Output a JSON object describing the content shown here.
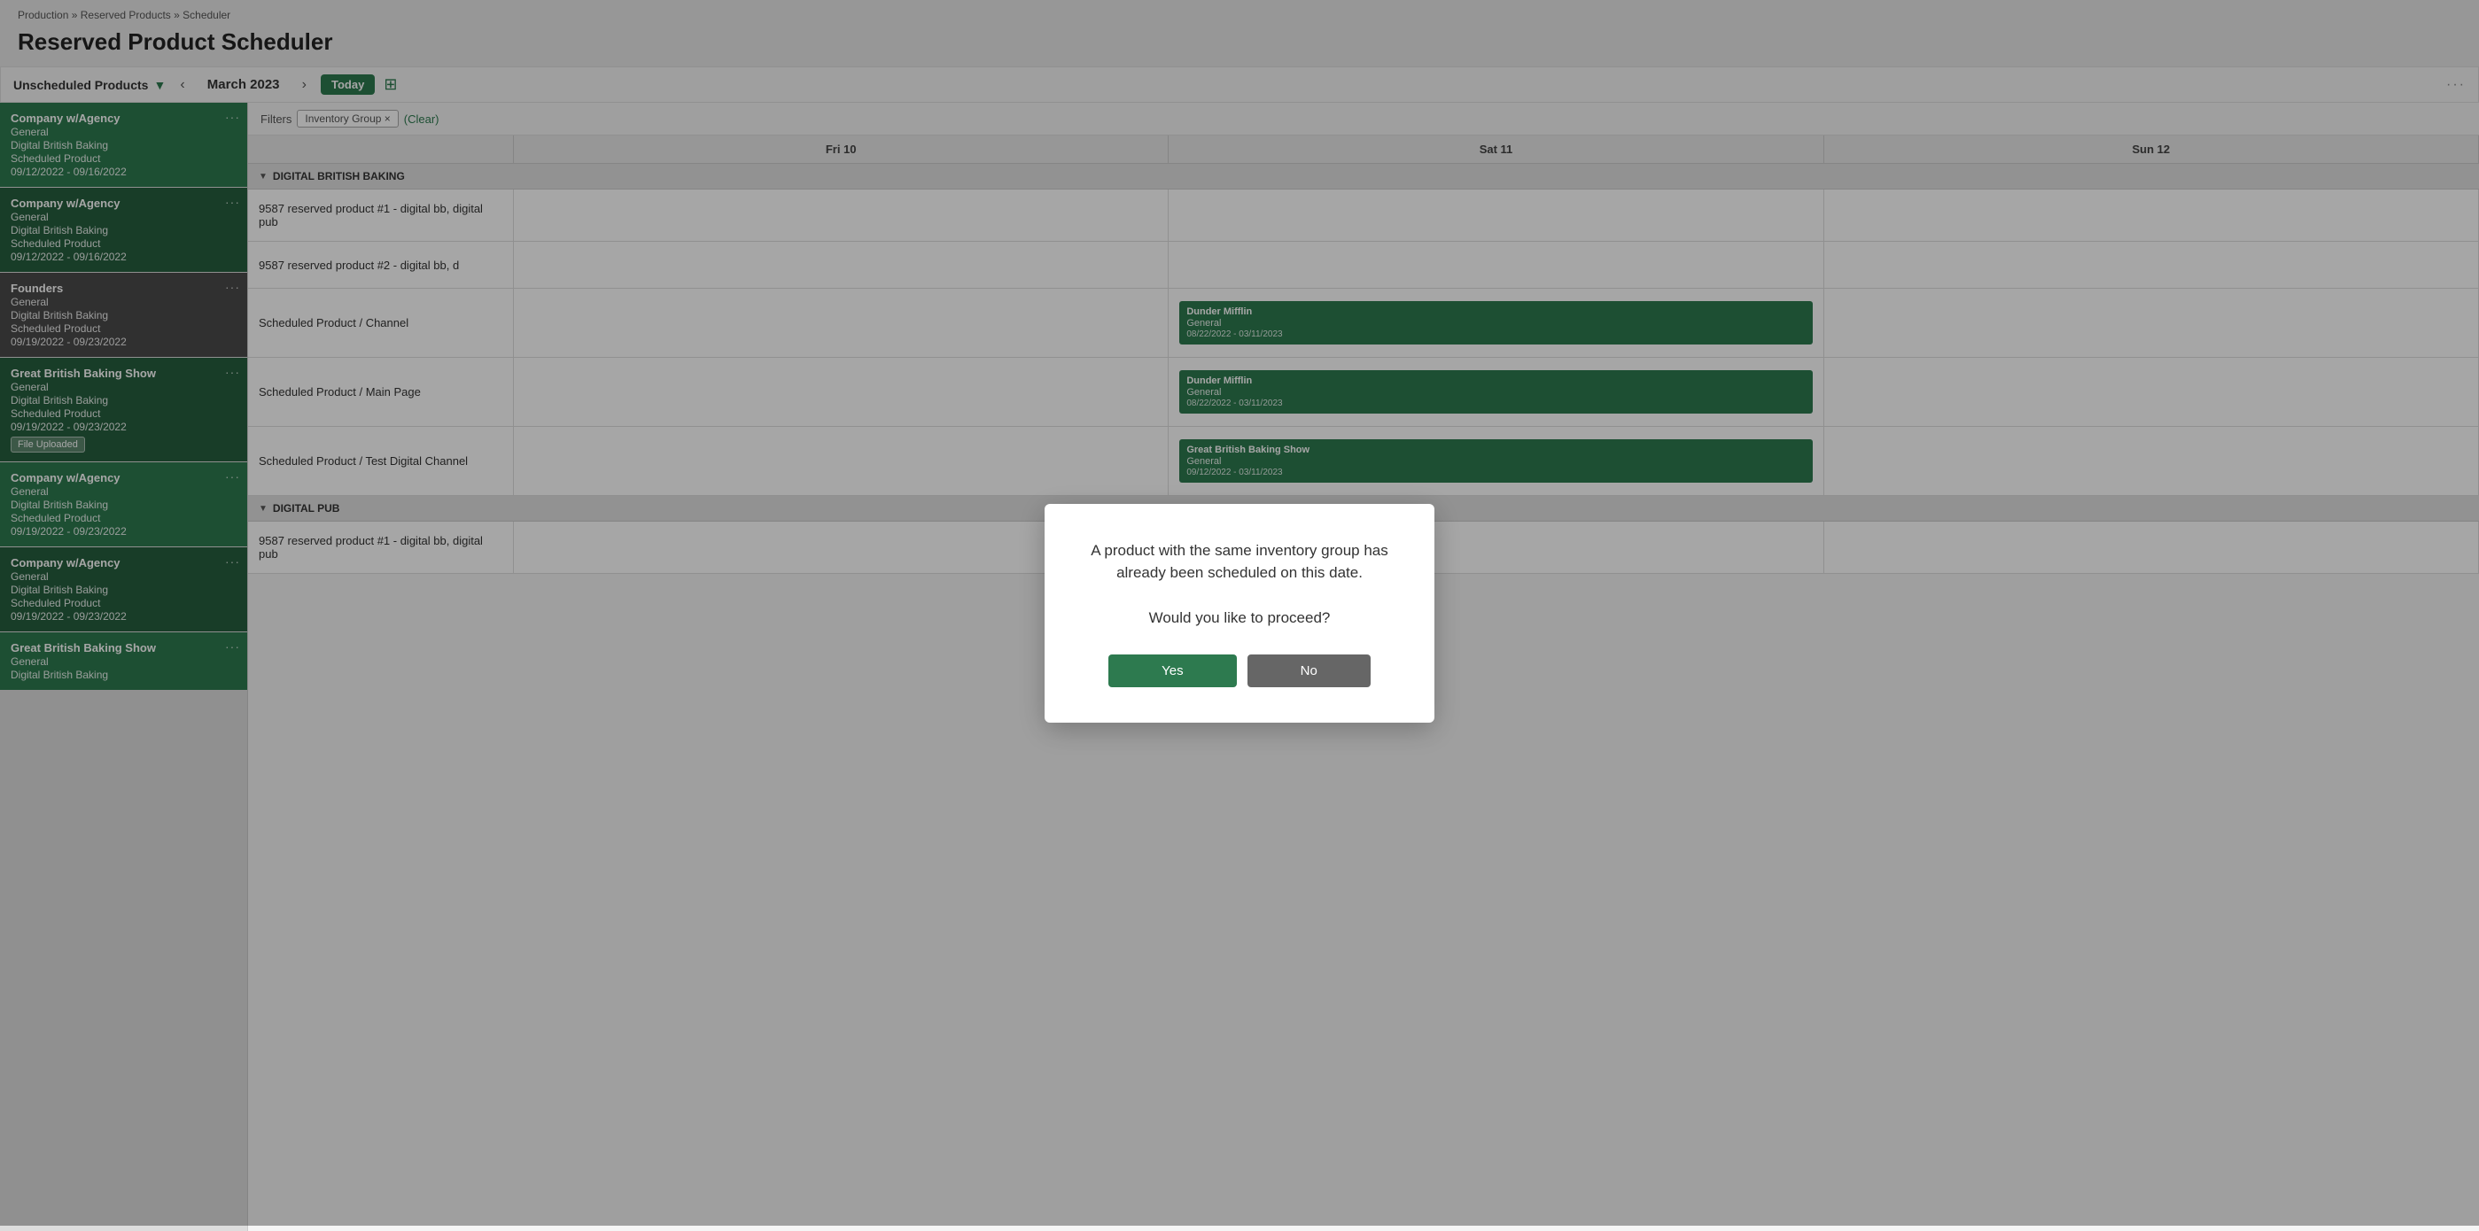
{
  "breadcrumb": {
    "items": [
      "Production",
      "Reserved Products",
      "Scheduler"
    ]
  },
  "page": {
    "title": "Reserved Product Scheduler"
  },
  "toolbar": {
    "unscheduled_label": "Unscheduled Products",
    "month": "March 2023",
    "today_label": "Today",
    "ellipsis": "···"
  },
  "filter_bar": {
    "label": "Filters",
    "tag": "Inventory Group ×",
    "clear": "(Clear)"
  },
  "calendar": {
    "columns": [
      "",
      "Fri 10",
      "Sat 11",
      "Sun 12"
    ],
    "sections": [
      {
        "name": "DIGITAL BRITISH BAKING",
        "rows": [
          {
            "label": "9587 reserved product #1 - digital bb, digital pub",
            "fri": "",
            "sat": "",
            "sun": ""
          },
          {
            "label": "9587 reserved product #2 - digital bb, d",
            "fri": "",
            "sat": "",
            "sun": ""
          },
          {
            "label": "Scheduled Product / Channel",
            "fri": "",
            "sat": {
              "title": "Dunder Mifflin",
              "sub": "General",
              "date": "08/22/2022 - 03/11/2023"
            },
            "sun": ""
          },
          {
            "label": "Scheduled Product / Main Page",
            "fri": "",
            "sat": {
              "title": "Dunder Mifflin",
              "sub": "General",
              "date": "08/22/2022 - 03/11/2023"
            },
            "sun": ""
          },
          {
            "label": "Scheduled Product / Test Digital Channel",
            "fri": "",
            "sat": {
              "title": "Great British Baking Show",
              "sub": "General",
              "date": "09/12/2022 - 03/11/2023"
            },
            "sun": ""
          }
        ]
      },
      {
        "name": "DIGITAL PUB",
        "rows": [
          {
            "label": "9587 reserved product #1 - digital bb, digital pub",
            "fri": "",
            "sat": "",
            "sun": ""
          }
        ]
      }
    ]
  },
  "sidebar": {
    "cards": [
      {
        "title": "Company w/Agency",
        "lines": [
          "General",
          "Digital British Baking",
          "Scheduled Product",
          "09/12/2022 - 09/16/2022"
        ],
        "variant": "green",
        "badge": null
      },
      {
        "title": "Company w/Agency",
        "lines": [
          "General",
          "Digital British Baking",
          "Scheduled Product",
          "09/12/2022 - 09/16/2022"
        ],
        "variant": "green",
        "badge": null
      },
      {
        "title": "Founders",
        "lines": [
          "General",
          "Digital British Baking",
          "Scheduled Product",
          "09/19/2022 - 09/23/2022"
        ],
        "variant": "dark",
        "badge": null
      },
      {
        "title": "Great British Baking Show",
        "lines": [
          "General",
          "Digital British Baking",
          "Scheduled Product",
          "09/19/2022 - 09/23/2022"
        ],
        "variant": "green",
        "badge": "File Uploaded"
      },
      {
        "title": "Company w/Agency",
        "lines": [
          "General",
          "Digital British Baking",
          "Scheduled Product",
          "09/19/2022 - 09/23/2022"
        ],
        "variant": "green",
        "badge": null
      },
      {
        "title": "Company w/Agency",
        "lines": [
          "General",
          "Digital British Baking",
          "Scheduled Product",
          "09/19/2022 - 09/23/2022"
        ],
        "variant": "green",
        "badge": null
      },
      {
        "title": "Great British Baking Show",
        "lines": [
          "General",
          "Digital British Baking"
        ],
        "variant": "green",
        "badge": null
      }
    ]
  },
  "modal": {
    "message_line1": "A product with the same inventory group has",
    "message_line2": "already been scheduled on this date.",
    "question": "Would you like to proceed?",
    "yes_label": "Yes",
    "no_label": "No"
  }
}
